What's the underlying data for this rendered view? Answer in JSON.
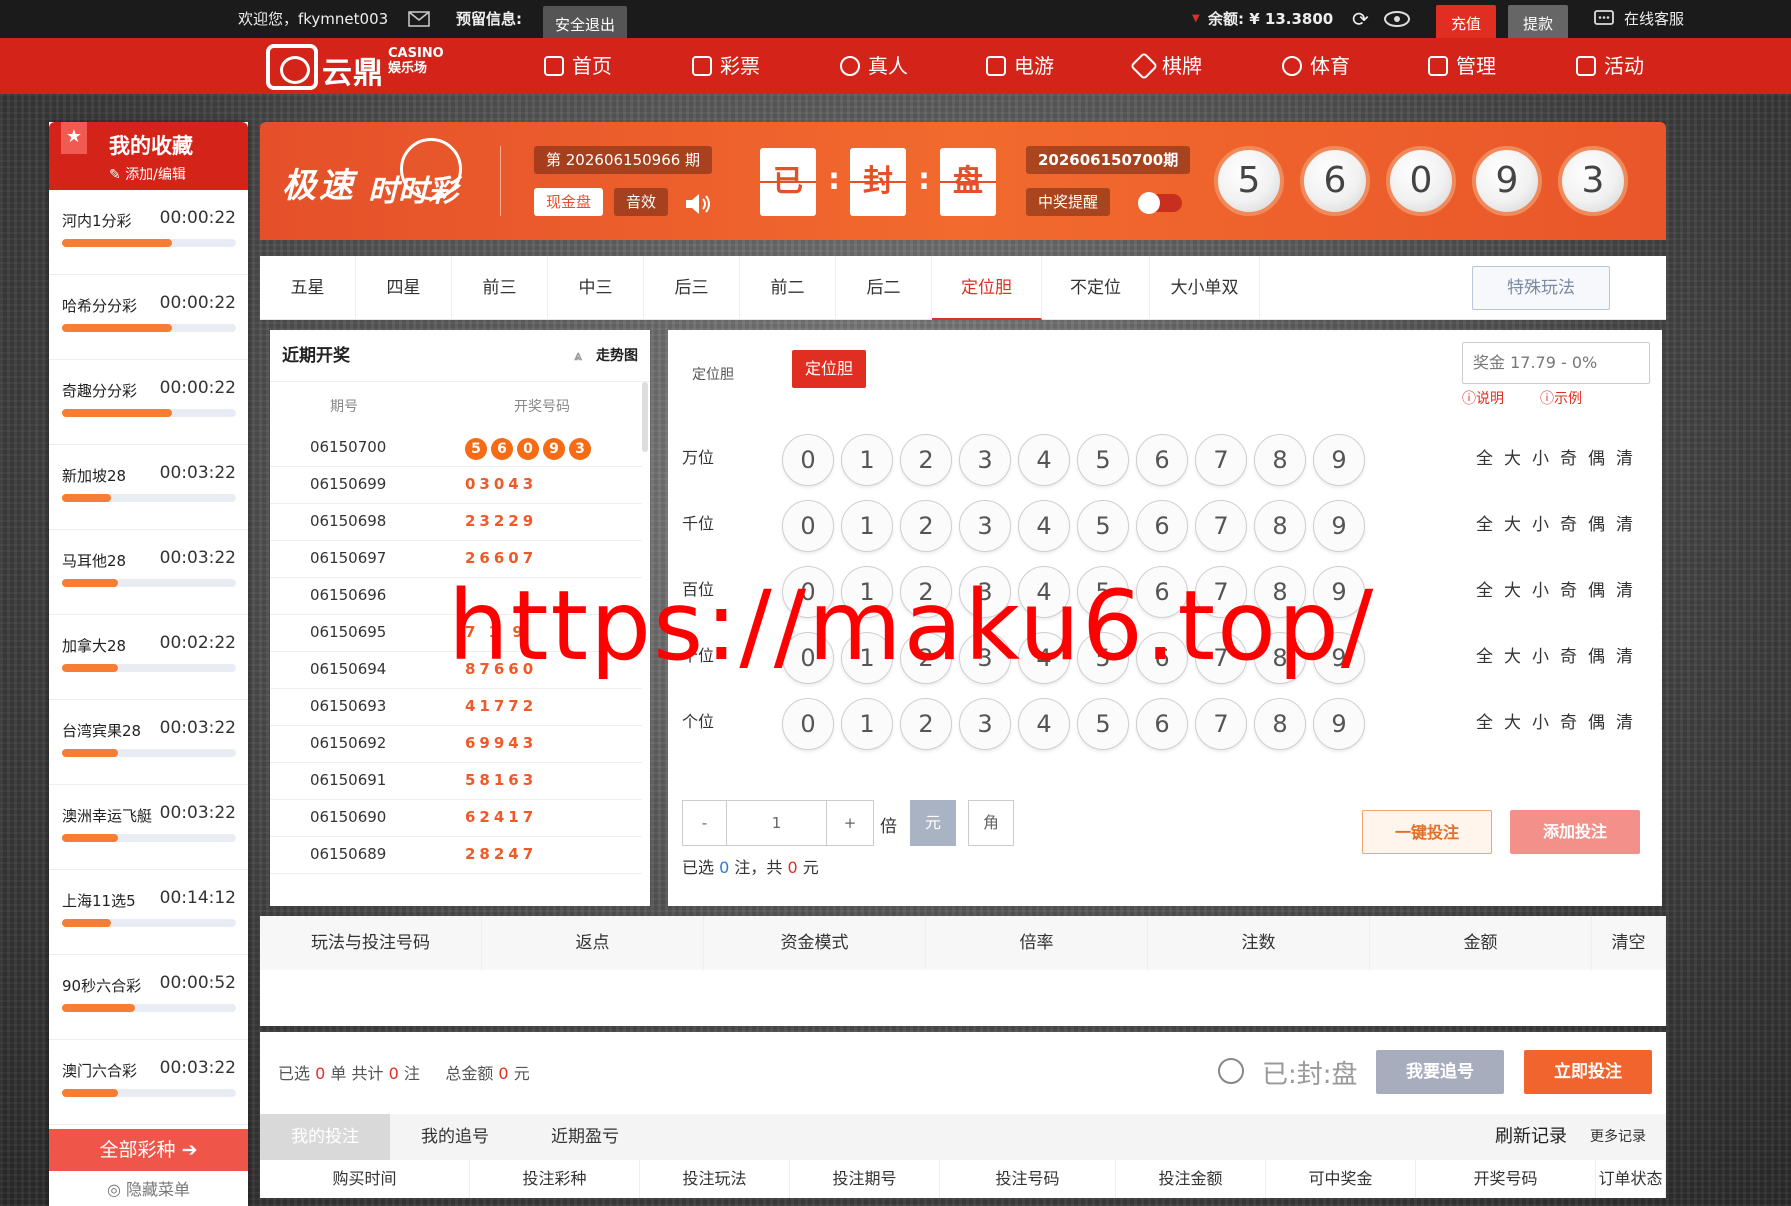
{
  "topbar": {
    "welcome": "欢迎您，fkymnet003",
    "reserved_label": "预留信息:",
    "logout": "安全退出",
    "balance": "余额: ¥ 13.3800",
    "recharge": "充值",
    "withdraw": "提款",
    "service": "在线客服"
  },
  "nav": {
    "logo_cn": "云鼎",
    "logo_en": "CASINO",
    "logo_sub": "娱乐场",
    "items": [
      "首页",
      "彩票",
      "真人",
      "电游",
      "棋牌",
      "体育",
      "管理",
      "活动"
    ]
  },
  "sidebar": {
    "title": "我的收藏",
    "edit": "添加/编辑",
    "favorites": [
      {
        "name": "河内1分彩",
        "time": "00:00:22",
        "progress": 0.63
      },
      {
        "name": "哈希分分彩",
        "time": "00:00:22",
        "progress": 0.63
      },
      {
        "name": "奇趣分分彩",
        "time": "00:00:22",
        "progress": 0.63
      },
      {
        "name": "新加坡28",
        "time": "00:03:22",
        "progress": 0.28
      },
      {
        "name": "马耳他28",
        "time": "00:03:22",
        "progress": 0.32
      },
      {
        "name": "加拿大28",
        "time": "00:02:22",
        "progress": 0.32
      },
      {
        "name": "台湾宾果28",
        "time": "00:03:22",
        "progress": 0.32
      },
      {
        "name": "澳洲幸运飞艇",
        "time": "00:03:22",
        "progress": 0.32
      },
      {
        "name": "上海11选5",
        "time": "00:14:12",
        "progress": 0.28
      },
      {
        "name": "90秒六合彩",
        "time": "00:00:52",
        "progress": 0.42
      },
      {
        "name": "澳门六合彩",
        "time": "00:03:22",
        "progress": 0.32
      }
    ],
    "all": "全部彩种",
    "hide": "隐藏菜单"
  },
  "lottery": {
    "name1": "极速",
    "name2": "时时彩",
    "current_issue": "第 202606150966 期",
    "cash_tag": "现金盘",
    "sound": "音效",
    "flip": [
      "已",
      "封",
      "盘"
    ],
    "last_issue": "202606150700期",
    "win_alert": "中奖提醒",
    "balls": [
      "5",
      "6",
      "0",
      "9",
      "3"
    ]
  },
  "tabs": [
    "五星",
    "四星",
    "前三",
    "中三",
    "后三",
    "前二",
    "后二",
    "定位胆",
    "不定位",
    "大小单双"
  ],
  "active_tab": "定位胆",
  "special_tab": "特殊玩法",
  "draws": {
    "title": "近期开奖",
    "trend": "走势图",
    "col_issue": "期号",
    "col_number": "开奖号码",
    "rows": [
      {
        "issue": "06150700",
        "num": "56093"
      },
      {
        "issue": "06150699",
        "num": "03043"
      },
      {
        "issue": "06150698",
        "num": "23229"
      },
      {
        "issue": "06150697",
        "num": "26607"
      },
      {
        "issue": "06150696",
        "num": ""
      },
      {
        "issue": "06150695",
        "num": "7 1 9"
      },
      {
        "issue": "06150694",
        "num": "87660"
      },
      {
        "issue": "06150693",
        "num": "41772"
      },
      {
        "issue": "06150692",
        "num": "69943"
      },
      {
        "issue": "06150691",
        "num": "58163"
      },
      {
        "issue": "06150690",
        "num": "62417"
      },
      {
        "issue": "06150689",
        "num": "28247"
      }
    ]
  },
  "bet": {
    "mode_label": "定位胆",
    "mode_button": "定位胆",
    "prize": "奖金 17.79 - 0%",
    "explain": "说明",
    "example": "示例",
    "positions": [
      "万位",
      "千位",
      "百位",
      "十位",
      "个位"
    ],
    "digits": [
      "0",
      "1",
      "2",
      "3",
      "4",
      "5",
      "6",
      "7",
      "8",
      "9"
    ],
    "filters": [
      "全",
      "大",
      "小",
      "奇",
      "偶",
      "清"
    ],
    "minus": "-",
    "multiple": "1",
    "plus": "+",
    "times": "倍",
    "unit_yuan": "元",
    "unit_jiao": "角",
    "sel_prefix": "已选",
    "sel_count": "0",
    "sel_mid": "注，共",
    "sel_amount": "0",
    "sel_suffix": "元",
    "one_click": "一键投注",
    "add_bet": "添加投注"
  },
  "cart_headers": [
    "玩法与投注号码",
    "返点",
    "资金模式",
    "倍率",
    "注数",
    "金额",
    "清空"
  ],
  "footer": {
    "sel_a": "已选",
    "sel_b": "0",
    "sel_c": "单 共计",
    "sel_d": "0",
    "sel_e": "注",
    "total_a": "总金额",
    "total_b": "0",
    "total_c": "元",
    "sealed": "已:封:盘",
    "chase": "我要追号",
    "bet_now": "立即投注"
  },
  "history_tabs": [
    "我的投注",
    "我的追号",
    "近期盈亏"
  ],
  "refresh": "刷新记录",
  "more": "更多记录",
  "history_cols": [
    "购买时间",
    "投注彩种",
    "投注玩法",
    "投注期号",
    "投注号码",
    "投注金额",
    "可中奖金",
    "开奖号码",
    "订单状态"
  ],
  "watermark": "https://maku6.top/",
  "colors": {
    "brand_red": "#d4241a",
    "orange": "#f26a2e",
    "accent_blue": "#2a7ae2"
  }
}
